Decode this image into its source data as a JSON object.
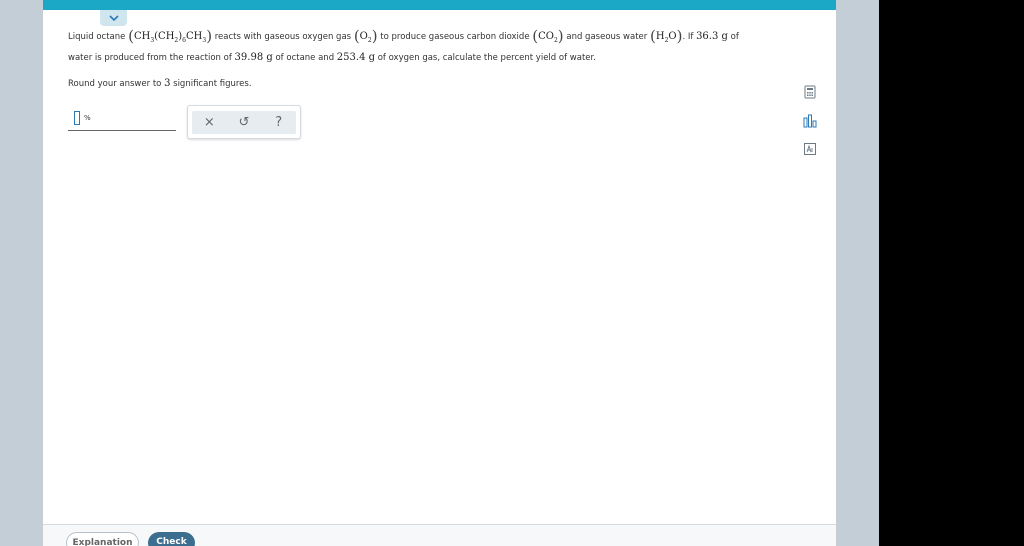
{
  "question": {
    "t1": "Liquid octane",
    "octane_a": "CH",
    "octane_s1": "3",
    "octane_b": "(CH",
    "octane_s2": "2",
    "octane_c": ")",
    "octane_s3": "6",
    "octane_d": "CH",
    "octane_s4": "3",
    "t2": "reacts with gaseous oxygen gas",
    "o2_a": "O",
    "o2_s": "2",
    "t3": "to produce gaseous carbon dioxide",
    "co2_a": "CO",
    "co2_s": "2",
    "t4": "and gaseous water",
    "h2o_a": "H",
    "h2o_s": "2",
    "h2o_b": "O",
    "t5": ". If",
    "water_mass": "36.3 g",
    "t6": "of",
    "t7": "water is produced from the reaction of",
    "octane_mass": "39.98 g",
    "t8": "of octane and",
    "oxygen_mass": "253.4 g",
    "t9": "of oxygen gas, calculate the percent yield of water.",
    "round_a": "Round your answer to",
    "round_n": "3",
    "round_b": "significant figures."
  },
  "answer": {
    "value": "",
    "unit": "%"
  },
  "toolbox": {
    "clear": "×",
    "undo": "↺",
    "help": "?"
  },
  "buttons": {
    "explanation": "Explanation",
    "check": "Check"
  },
  "colors": {
    "accent": "#1ba8c6",
    "check_button": "#3b6e8f"
  }
}
